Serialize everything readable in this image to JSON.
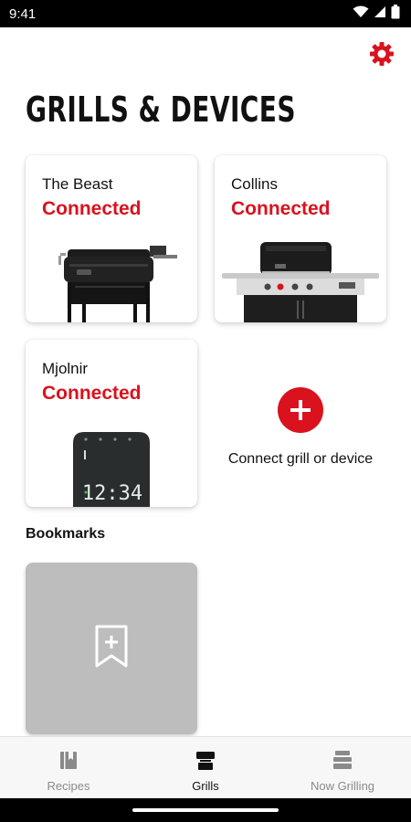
{
  "status_bar": {
    "time": "9:41",
    "icons": [
      "wifi-icon",
      "signal-icon",
      "battery-icon"
    ]
  },
  "header": {
    "settings_icon": "gear-icon",
    "title": "GRILLS & DEVICES"
  },
  "devices": [
    {
      "name": "The Beast",
      "status": "Connected",
      "image": "pellet-grill"
    },
    {
      "name": "Collins",
      "status": "Connected",
      "image": "gas-grill"
    },
    {
      "name": "Mjolnir",
      "status": "Connected",
      "image": "thermometer-hub",
      "display": "12:34"
    }
  ],
  "connect": {
    "label": "Connect grill or device",
    "icon": "plus-icon"
  },
  "bookmarks": {
    "title": "Bookmarks",
    "icon": "bookmark-add-icon"
  },
  "bottom_nav": [
    {
      "label": "Recipes",
      "icon": "book-icon",
      "active": false
    },
    {
      "label": "Grills",
      "icon": "grill-icon",
      "active": true
    },
    {
      "label": "Now Grilling",
      "icon": "layers-icon",
      "active": false
    }
  ],
  "colors": {
    "accent": "#d9121e",
    "text": "#111111",
    "muted": "#8a8a8a",
    "bookmark_tile": "#bdbdbd"
  }
}
